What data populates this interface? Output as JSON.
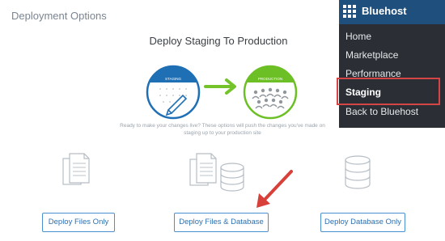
{
  "page": {
    "title": "Deployment Options",
    "heading": "Deploy Staging To Production",
    "description": "Ready to make your changes live? These options will push the changes you've made on staging up to your production site"
  },
  "diagram": {
    "staging_label": "STAGING",
    "production_label": "PRODUCTION",
    "colors": {
      "staging": "#1f6fb5",
      "production": "#6cbf24",
      "arrow": "#74c32b"
    }
  },
  "buttons": {
    "deploy_files": "Deploy Files Only",
    "deploy_files_db": "Deploy Files & Database",
    "deploy_db": "Deploy Database Only"
  },
  "sidebar": {
    "brand": "Bluehost",
    "items": [
      {
        "label": "Home"
      },
      {
        "label": "Marketplace"
      },
      {
        "label": "Performance"
      },
      {
        "label": "Staging",
        "highlighted": true
      },
      {
        "label": "Back to Bluehost"
      }
    ]
  },
  "icons": [
    "files-icon",
    "files-database-icon",
    "database-icon",
    "grid-logo-icon",
    "pencil-icon"
  ]
}
